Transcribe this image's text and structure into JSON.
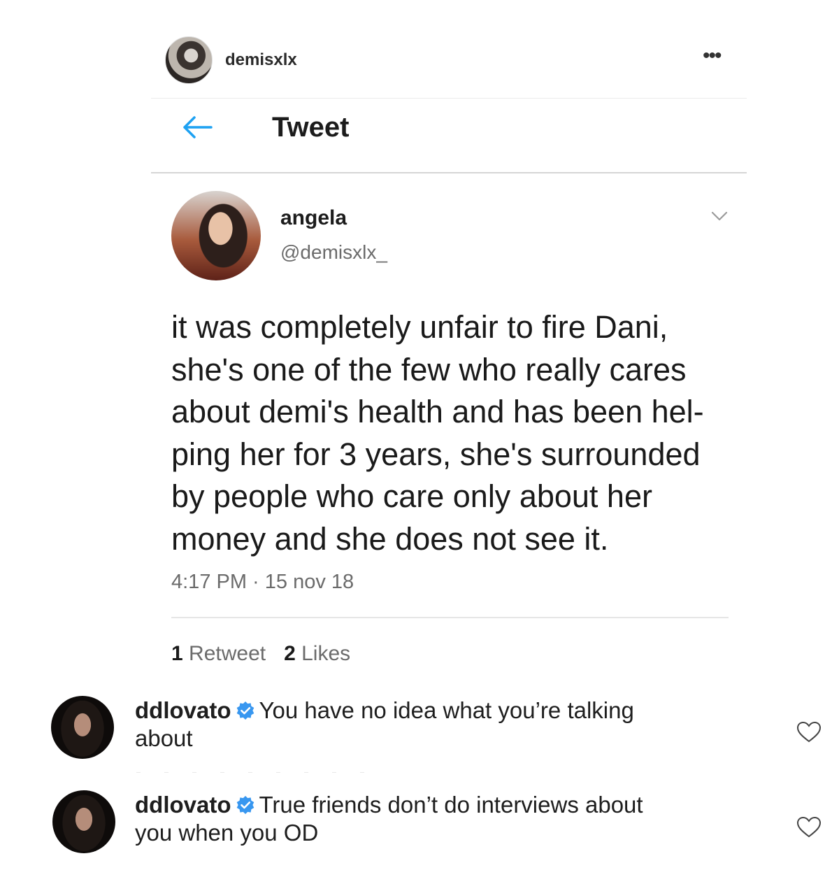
{
  "post": {
    "username": "demisxlx",
    "more_icon": "more-horizontal-icon"
  },
  "tweet_view": {
    "back_icon": "arrow-left-icon",
    "heading": "Tweet"
  },
  "tweet": {
    "author_name": "angela",
    "author_handle": "@demisxlx_",
    "text_lines": [
      "it was completely unfair to fire Dani,",
      "she's one of the few who really cares",
      "about demi's health and has been hel-",
      "ping her for 3 years, she's surrounded",
      "by people who care only about her",
      "money and she does not see it."
    ],
    "timestamp": "4:17 PM · 15 nov 18",
    "retweets_count": "1",
    "retweets_label": "Retweet",
    "likes_count": "2",
    "likes_label": "Likes"
  },
  "comments": [
    {
      "username": "ddlovato",
      "verified": true,
      "text_line1": "You have no idea what you’re talking",
      "text_line2": "about"
    },
    {
      "username": "ddlovato",
      "verified": true,
      "text_line1": "True friends don’t do interviews about",
      "text_line2": "you when you OD"
    }
  ],
  "colors": {
    "accent_blue": "#3897f0",
    "twitter_blue": "#1da1f2",
    "muted_text": "#6b6b6b"
  }
}
